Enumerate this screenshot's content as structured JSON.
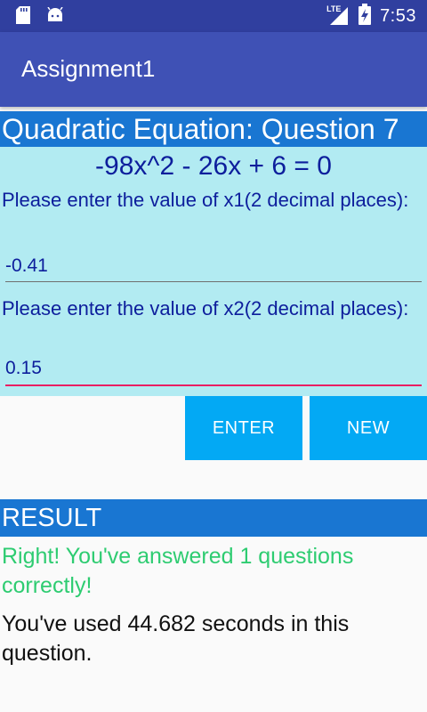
{
  "status_bar": {
    "time": "7:53",
    "network_label": "LTE",
    "icons": [
      "sd-card-icon",
      "android-icon",
      "signal-icon",
      "battery-charging-icon"
    ]
  },
  "app_bar": {
    "title": "Assignment1"
  },
  "question": {
    "header": "Quadratic Equation: Question 7",
    "equation": "-98x^2 - 26x + 6 = 0",
    "x1_prompt": "Please enter the value of x1(2 decimal places):",
    "x1_value": "-0.41",
    "x2_prompt": "Please enter the value of x2(2 decimal places):",
    "x2_value": "0.15"
  },
  "buttons": {
    "enter_label": "ENTER",
    "new_label": "NEW"
  },
  "result": {
    "header": "RESULT",
    "message": "Right! You've answered 1 questions correctly!",
    "time_message": "You've used 44.682 seconds in this question."
  },
  "colors": {
    "status_bar": "#303f9f",
    "app_bar": "#3f51b5",
    "header_band": "#1976d2",
    "panel": "#b2ebf2",
    "button": "#03a9f4",
    "focused_underline": "#e91e63",
    "success_text": "#2ecc71"
  }
}
